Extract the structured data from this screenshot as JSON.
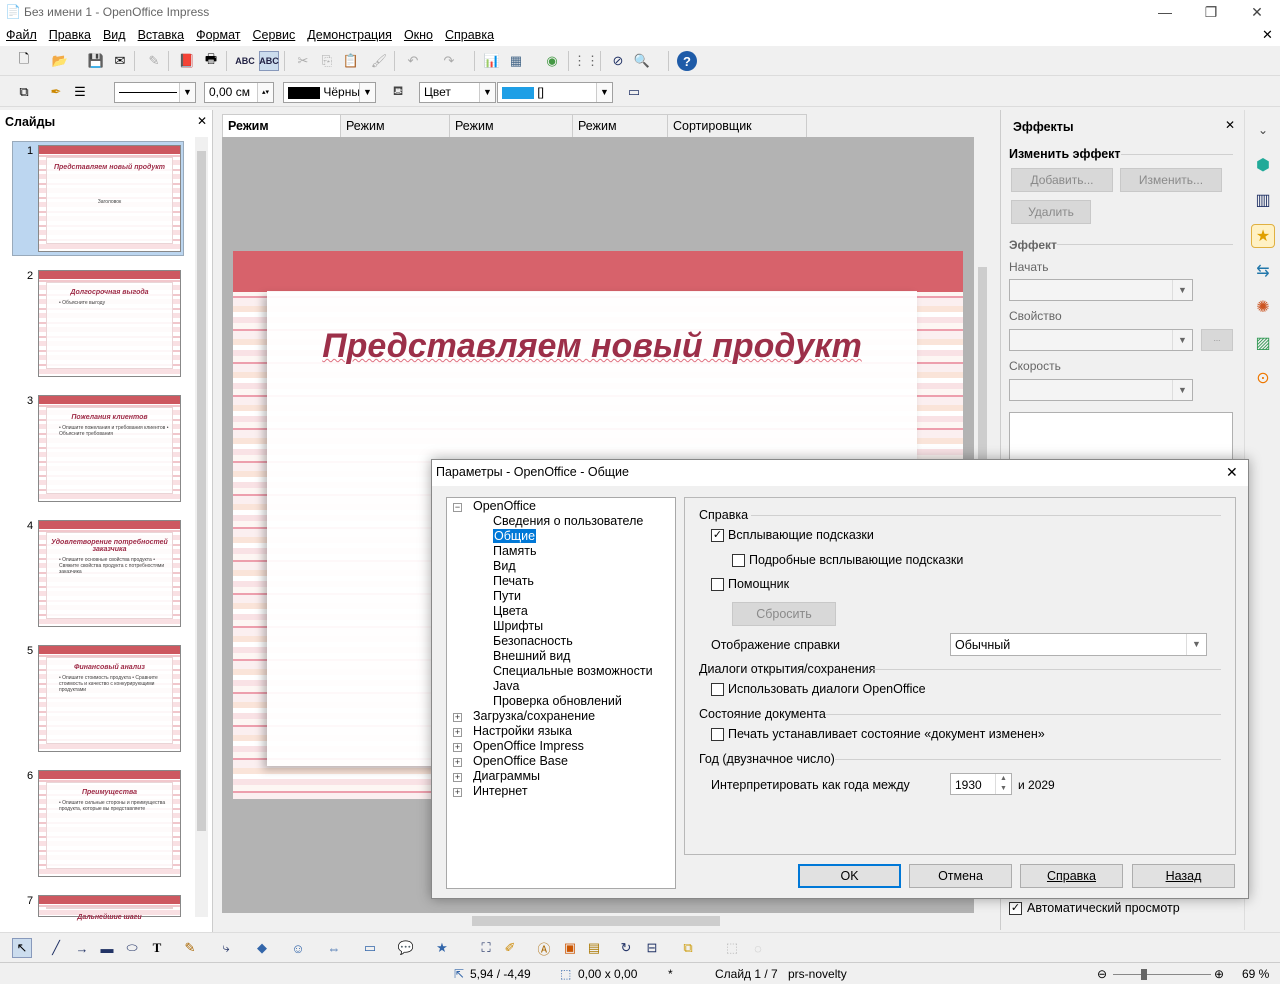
{
  "window": {
    "title": "Без имени 1 - OpenOffice Impress",
    "minimize": "—",
    "maximize": "❐",
    "close": "✕",
    "doc_close": "✕"
  },
  "menu": [
    "Файл",
    "Правка",
    "Вид",
    "Вставка",
    "Формат",
    "Сервис",
    "Демонстрация",
    "Окно",
    "Справка"
  ],
  "line_style": {
    "line_width": "0,00 см",
    "line_color": "Чёрный",
    "area_style": "Цвет",
    "area_color": "[]",
    "line_color_swatch": "#000000",
    "area_color_swatch": "#1e9fe6"
  },
  "slides_panel": {
    "title": "Слайды",
    "close": "✕",
    "slides": [
      {
        "num": "1",
        "title": "Представляем новый продукт",
        "body": "Заголовок"
      },
      {
        "num": "2",
        "title": "Долгосрочная выгода",
        "body": "• Объясните выгоду"
      },
      {
        "num": "3",
        "title": "Пожелания клиентов",
        "body": "• Опишите пожелания и требования клиентов • Объясните требования"
      },
      {
        "num": "4",
        "title": "Удовлетворение потребностей заказчика",
        "body": "• Опишите основные свойства продукта • Свяжите свойства продукта с потребностями заказчика"
      },
      {
        "num": "5",
        "title": "Финансовый анализ",
        "body": "• Опишите стоимость продукта • Сравните стоимость и качество с конкурирующими продуктами"
      },
      {
        "num": "6",
        "title": "Преимущества",
        "body": "• Опишите сильные стороны и преимущества продукта, которые вы представляете"
      },
      {
        "num": "7",
        "title": "Дальнейшие шаги",
        "body": ""
      }
    ]
  },
  "view_tabs": [
    "Режим рисования",
    "Режим структуры",
    "Режим примечаний",
    "Режим тезисов",
    "Сортировщик слайдов"
  ],
  "slide": {
    "title": "Представляем новый продукт"
  },
  "effects_panel": {
    "title": "Эффекты",
    "close": "✕",
    "menu": "⌄",
    "change_effect": "Изменить эффект",
    "add": "Добавить...",
    "modify": "Изменить...",
    "remove": "Удалить",
    "effect": "Эффект",
    "start": "Начать",
    "property": "Свойство",
    "speed": "Скорость",
    "more": "...",
    "auto_preview": "Автоматический просмотр",
    "auto_preview_checked": true
  },
  "dialog": {
    "title": "Параметры - OpenOffice - Общие",
    "close": "✕",
    "tree": {
      "root": "OpenOffice",
      "children": [
        "Сведения о пользователе",
        "Общие",
        "Память",
        "Вид",
        "Печать",
        "Пути",
        "Цвета",
        "Шрифты",
        "Безопасность",
        "Внешний вид",
        "Специальные возможности",
        "Java",
        "Проверка обновлений"
      ],
      "selected": "Общие",
      "others": [
        "Загрузка/сохранение",
        "Настройки языка",
        "OpenOffice Impress",
        "OpenOffice Base",
        "Диаграммы",
        "Интернет"
      ]
    },
    "help_section": "Справка",
    "tooltips": "Всплывающие подсказки",
    "tooltips_checked": true,
    "extended_tips": "Подробные всплывающие подсказки",
    "extended_checked": false,
    "help_agent": "Помощник",
    "help_agent_checked": false,
    "reset": "Сбросить",
    "help_format_label": "Отображение справки",
    "help_format_value": "Обычный",
    "open_save_section": "Диалоги открытия/сохранения",
    "use_oo_dialogs": "Использовать диалоги OpenOffice",
    "use_oo_dialogs_checked": false,
    "doc_status_section": "Состояние документа",
    "print_sets_modified": "Печать устанавливает состояние «документ изменен»",
    "print_sets_modified_checked": false,
    "year_section": "Год (двузначное число)",
    "interpret_label": "Интерпретировать как года между",
    "year_start": "1930",
    "year_end": "и 2029",
    "ok": "OK",
    "cancel": "Отмена",
    "help": "Справка",
    "back": "Назад"
  },
  "status": {
    "position": "5,94 / -4,49",
    "size": "0,00 x 0,00",
    "modified": "*",
    "slide": "Слайд 1 / 7",
    "template": "prs-novelty",
    "zoom": "69 %"
  }
}
